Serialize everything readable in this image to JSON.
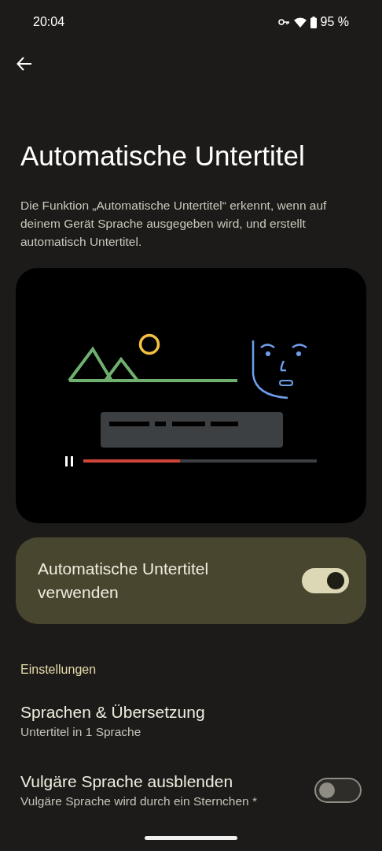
{
  "status_bar": {
    "time": "20:04",
    "battery": "95 %"
  },
  "title": "Automatische Untertitel",
  "description": "Die Funktion „Automatische Untertitel“ erkennt, wenn auf deinem Gerät Sprache ausgegeben wird, und erstellt automatisch Untertitel.",
  "main_switch": {
    "label": "Automatische Untertitel verwenden",
    "on": true
  },
  "section": "Einstellungen",
  "items": [
    {
      "kind": "link",
      "title": "Sprachen & Übersetzung",
      "subtitle": "Untertitel in 1 Sprache"
    },
    {
      "kind": "switch",
      "title": "Vulgäre Sprache ausblenden",
      "subtitle": "Vulgäre Sprache wird durch ein Sternchen *",
      "on": false
    }
  ]
}
